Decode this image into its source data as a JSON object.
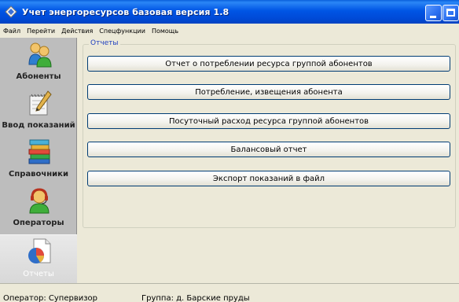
{
  "window": {
    "title": "Учет энергоресурсов базовая версия 1.8",
    "icon": "app-diamond-icon"
  },
  "menu": {
    "items": [
      "Файл",
      "Перейти",
      "Действия",
      "Спецфункции",
      "Помощь"
    ]
  },
  "sidebar": {
    "items": [
      {
        "label": "Абоненты",
        "icon": "subscribers-icon"
      },
      {
        "label": "Ввод показаний",
        "icon": "notepad-pencil-icon"
      },
      {
        "label": "Справочники",
        "icon": "books-icon"
      },
      {
        "label": "Операторы",
        "icon": "operator-headset-icon"
      },
      {
        "label": "Отчеты",
        "icon": "report-chart-icon",
        "active": true
      }
    ]
  },
  "reports": {
    "group_title": "Отчеты",
    "buttons": [
      "Отчет о потреблении ресурса группой абонентов",
      "Потребление, извещения абонента",
      "Посуточный расход ресурса группой абонентов",
      "Балансовый отчет",
      "Экспорт показаний в файл"
    ]
  },
  "status": {
    "operator": "Оператор: Супервизор",
    "group": "Группа: д. Барские пруды"
  }
}
